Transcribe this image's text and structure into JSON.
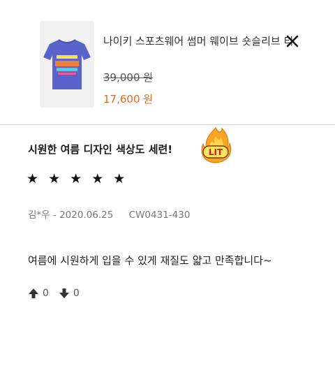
{
  "product": {
    "name": "나이키 스포츠웨어 썸머 웨이브 숏슬리브 티",
    "price_original": "39,000 원",
    "price_sale": "17,600 원",
    "shirt_color": "#5a63c9",
    "sale_color": "#e36b1f"
  },
  "review": {
    "title": "시원한 여름 디자인 색상도 세련!",
    "badge_icon": "lit-fire-emoji",
    "badge_text": "LIT",
    "stars": "★ ★ ★ ★ ★",
    "rating": 5,
    "author": "김*우",
    "date": "2020.06.25",
    "product_code": "CW0431-430",
    "body": "여름에 시원하게 입을 수 있게 재질도 얇고 만족합니다~",
    "upvotes": "0",
    "downvotes": "0"
  }
}
